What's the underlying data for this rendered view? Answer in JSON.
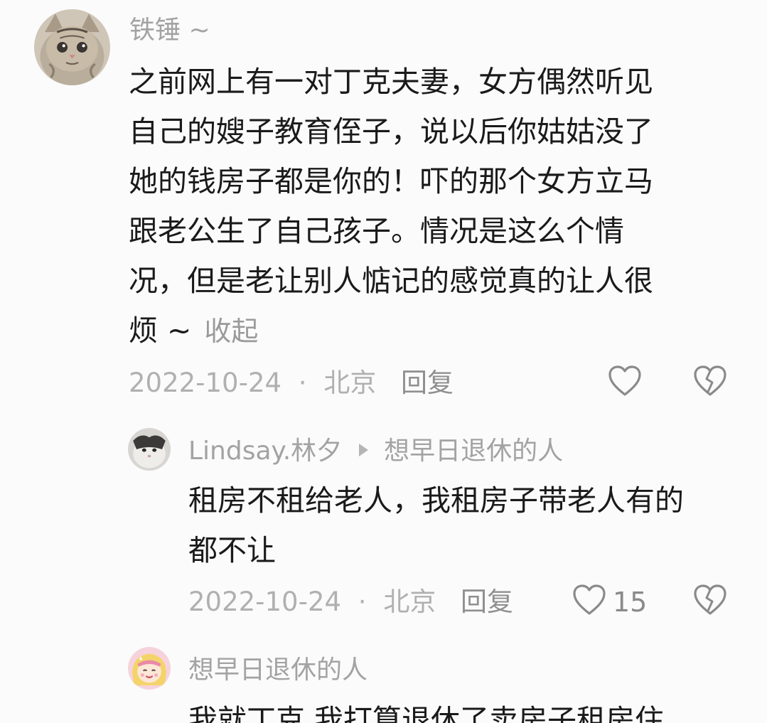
{
  "comment1": {
    "username": "铁锤 ~",
    "lines": [
      "之前网上有一对丁克夫妻，女方偶然听见",
      "自己的嫂子教育侄子，说以后你姑姑没了",
      "她的钱房子都是你的！吓的那个女方立马",
      "跟老公生了自己孩子。情况是这么个情",
      "况，但是老让别人惦记的感觉真的让人很",
      "烦 ~"
    ],
    "collapse_label": "收起",
    "date": "2022-10-24",
    "location": "北京",
    "reply_label": "回复",
    "like_icon": "heart-outline-icon",
    "dislike_icon": "broken-heart-icon"
  },
  "reply1": {
    "username": "Lindsay.林夕",
    "reply_to": "想早日退休的人",
    "lines": [
      "租房不租给老人，我租房子带老人有的",
      "都不让"
    ],
    "date": "2022-10-24",
    "location": "北京",
    "reply_label": "回复",
    "like_count": "15"
  },
  "reply2": {
    "username": "想早日退休的人",
    "partial_line": "我就丁克 我打算退休了卖房子租房住"
  },
  "colors": {
    "background": "#fbfbfb",
    "username": "#a3a3a3",
    "body_text": "#1a1a1a",
    "meta": "#b0b0b0",
    "icon": "#8a8a8a"
  }
}
